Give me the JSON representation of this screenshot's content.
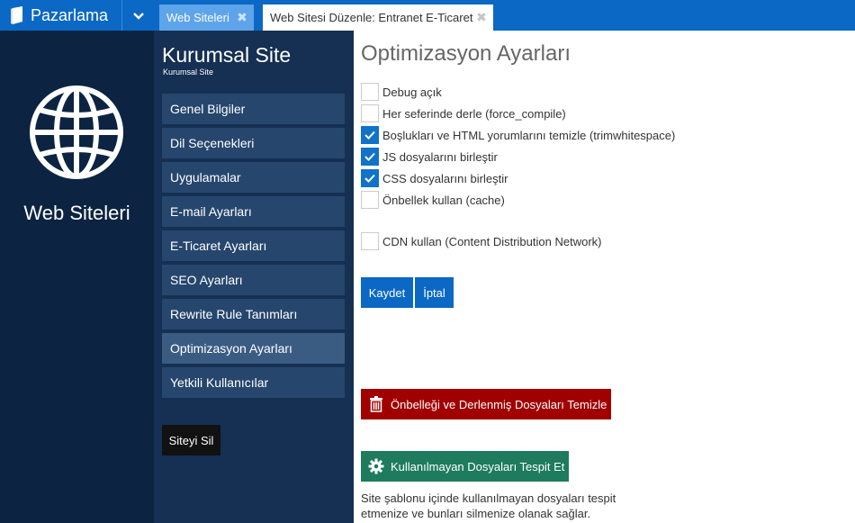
{
  "app": {
    "brand": "Pazarlama",
    "brand_logo_icon": "bookmark-logo-icon",
    "menu_icon": "chevron-down-icon"
  },
  "tabs": [
    {
      "label": "Web Siteleri",
      "close_icon": "close-icon",
      "state": "inactive"
    },
    {
      "label": "Web Sitesi Düzenle: Entranet E-Ticaret",
      "close_icon": "close-icon",
      "state": "active"
    }
  ],
  "left_panel": {
    "icon": "globe-icon",
    "title": "Web Siteleri"
  },
  "site": {
    "title": "Kurumsal Site",
    "subtitle": "Kurumsal Site"
  },
  "nav": {
    "items": [
      {
        "label": "Genel Bilgiler",
        "active": false
      },
      {
        "label": "Dil Seçenekleri",
        "active": false
      },
      {
        "label": "Uygulamalar",
        "active": false
      },
      {
        "label": "E-mail Ayarları",
        "active": false
      },
      {
        "label": "E-Ticaret Ayarları",
        "active": false
      },
      {
        "label": "SEO Ayarları",
        "active": false
      },
      {
        "label": "Rewrite Rule Tanımları",
        "active": false
      },
      {
        "label": "Optimizasyon Ayarları",
        "active": true
      },
      {
        "label": "Yetkili Kullanıcılar",
        "active": false
      }
    ],
    "delete_label": "Siteyi Sil"
  },
  "content": {
    "title": "Optimizasyon Ayarları",
    "options": [
      {
        "label": "Debug açık",
        "checked": false
      },
      {
        "label": "Her seferinde derle (force_compile)",
        "checked": false
      },
      {
        "label": "Boşlukları ve HTML yorumlarını temizle (trimwhitespace)",
        "checked": true
      },
      {
        "label": "JS dosyalarını birleştir",
        "checked": true
      },
      {
        "label": "CSS dosyalarını birleştir",
        "checked": true
      },
      {
        "label": "Önbellek kullan (cache)",
        "checked": false
      },
      {
        "label": "CDN kullan (Content Distribution Network)",
        "checked": false
      }
    ],
    "save_label": "Kaydet",
    "cancel_label": "İptal",
    "clear_cache_label": "Önbelleği ve Derlenmiş Dosyaları Temizle",
    "clear_cache_icon": "trash-icon",
    "detect_unused_label": "Kullanılmayan Dosyaları Tespit Et",
    "detect_unused_icon": "gear-icon",
    "help_text": "Site şablonu içinde kullanılmayan dosyaları tespit etmenize ve bunları silmenize olanak sağlar."
  },
  "colors": {
    "topbar": "#0b68c5",
    "left_panel": "#0c2442",
    "nav_panel": "#153052",
    "nav_item": "#26466d",
    "nav_item_active": "#3b5c82",
    "checkbox_checked": "#1072c9",
    "danger": "#a00000",
    "success": "#1e7b5e"
  }
}
